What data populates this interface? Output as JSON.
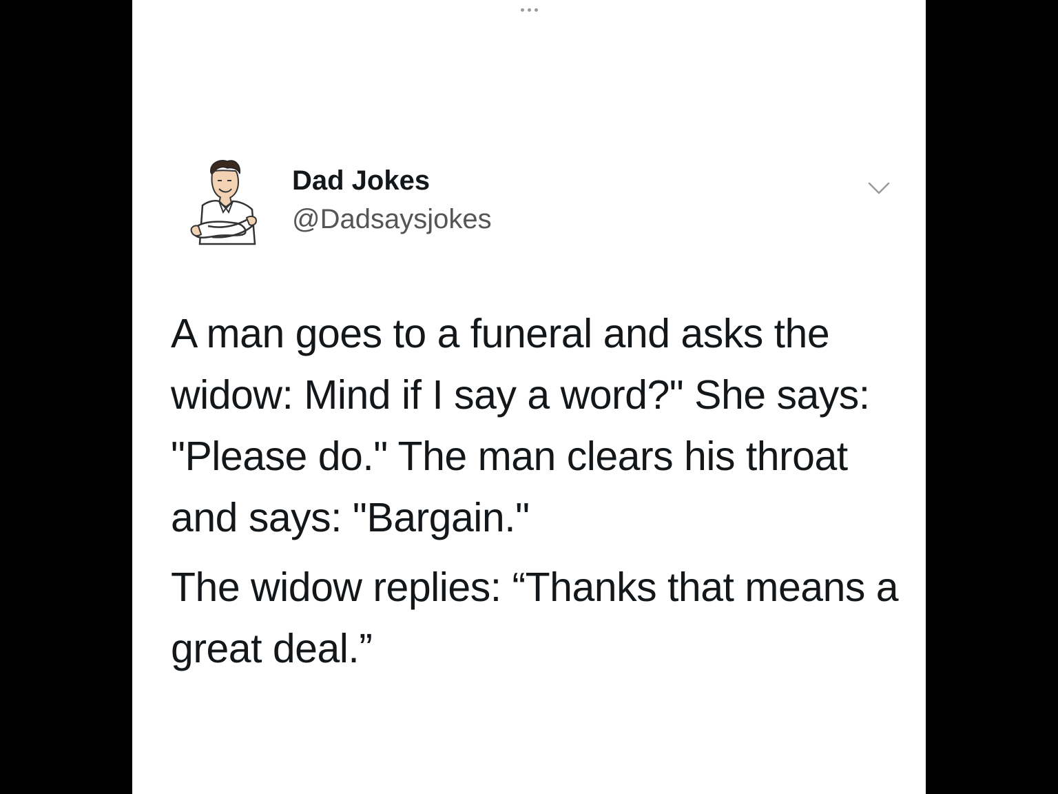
{
  "tweet": {
    "more_icon": "ellipsis-icon",
    "author": {
      "display_name": "Dad Jokes",
      "handle": "@Dadsaysjokes",
      "avatar_icon": "cartoon-man-avatar"
    },
    "menu_icon": "chevron-down-icon",
    "paragraphs": [
      "A man goes to a funeral and asks the widow: Mind if I say a word?\" She says: \"Please do.\" The man clears his throat and says: \"Bargain.\"",
      "The widow replies: “Thanks that means a great deal.”"
    ]
  },
  "colors": {
    "background": "#000000",
    "card": "#ffffff",
    "text": "#14171a",
    "handle": "#555555"
  }
}
